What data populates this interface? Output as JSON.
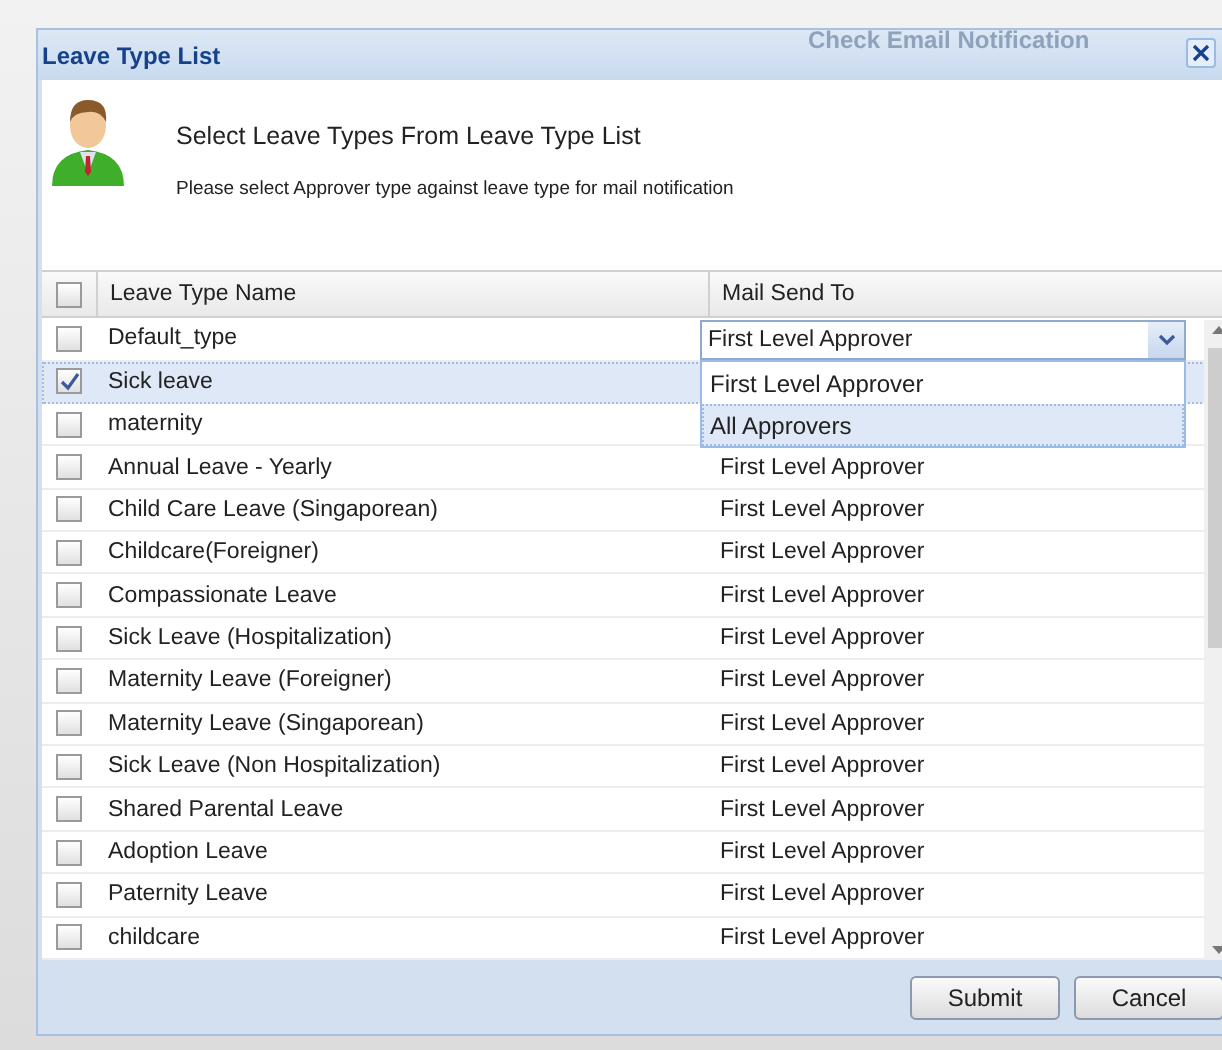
{
  "window": {
    "title": "Leave Type List",
    "background_title": "Check Email Notification"
  },
  "header": {
    "heading": "Select Leave Types From Leave Type List",
    "instruction": "Please select Approver type against leave type for mail notification"
  },
  "table": {
    "columns": [
      "Leave Type Name",
      "Mail Send To"
    ],
    "all_checked": false,
    "rows": [
      {
        "name": "Default_type",
        "mail": "First Level Approver",
        "checked": false,
        "selected": false,
        "kind": "editor"
      },
      {
        "name": "Sick leave",
        "checked": true,
        "selected": true,
        "kind": "plain"
      },
      {
        "name": "maternity",
        "checked": false,
        "selected": false,
        "kind": "plain"
      },
      {
        "name": "Annual Leave - Yearly",
        "mail": "First Level Approver",
        "checked": false,
        "selected": false,
        "kind": "plain"
      },
      {
        "name": "Child Care Leave (Singaporean)",
        "mail": "First Level Approver",
        "checked": false,
        "selected": false,
        "kind": "plain"
      },
      {
        "name": "Childcare(Foreigner)",
        "mail": "First Level Approver",
        "checked": false,
        "selected": false,
        "kind": "plain"
      },
      {
        "name": "Compassionate Leave",
        "mail": "First Level Approver",
        "checked": false,
        "selected": false,
        "kind": "plain"
      },
      {
        "name": "Sick Leave (Hospitalization)",
        "mail": "First Level Approver",
        "checked": false,
        "selected": false,
        "kind": "plain"
      },
      {
        "name": "Maternity Leave (Foreigner)",
        "mail": "First Level Approver",
        "checked": false,
        "selected": false,
        "kind": "plain"
      },
      {
        "name": "Maternity Leave (Singaporean)",
        "mail": "First Level Approver",
        "checked": false,
        "selected": false,
        "kind": "plain"
      },
      {
        "name": "Sick Leave (Non Hospitalization)",
        "mail": "First Level Approver",
        "checked": false,
        "selected": false,
        "kind": "plain"
      },
      {
        "name": "Shared Parental Leave",
        "mail": "First Level Approver",
        "checked": false,
        "selected": false,
        "kind": "plain"
      },
      {
        "name": "Adoption Leave",
        "mail": "First Level Approver",
        "checked": false,
        "selected": false,
        "kind": "plain"
      },
      {
        "name": "Paternity Leave",
        "mail": "First Level Approver",
        "checked": false,
        "selected": false,
        "kind": "plain"
      },
      {
        "name": "childcare",
        "mail": "First Level Approver",
        "checked": false,
        "selected": false,
        "kind": "plain"
      }
    ],
    "dropdown": {
      "options": [
        {
          "label": "First Level Approver",
          "selected": false
        },
        {
          "label": "All Approvers",
          "selected": true
        }
      ]
    }
  },
  "buttons": [
    "Submit",
    "Cancel"
  ]
}
